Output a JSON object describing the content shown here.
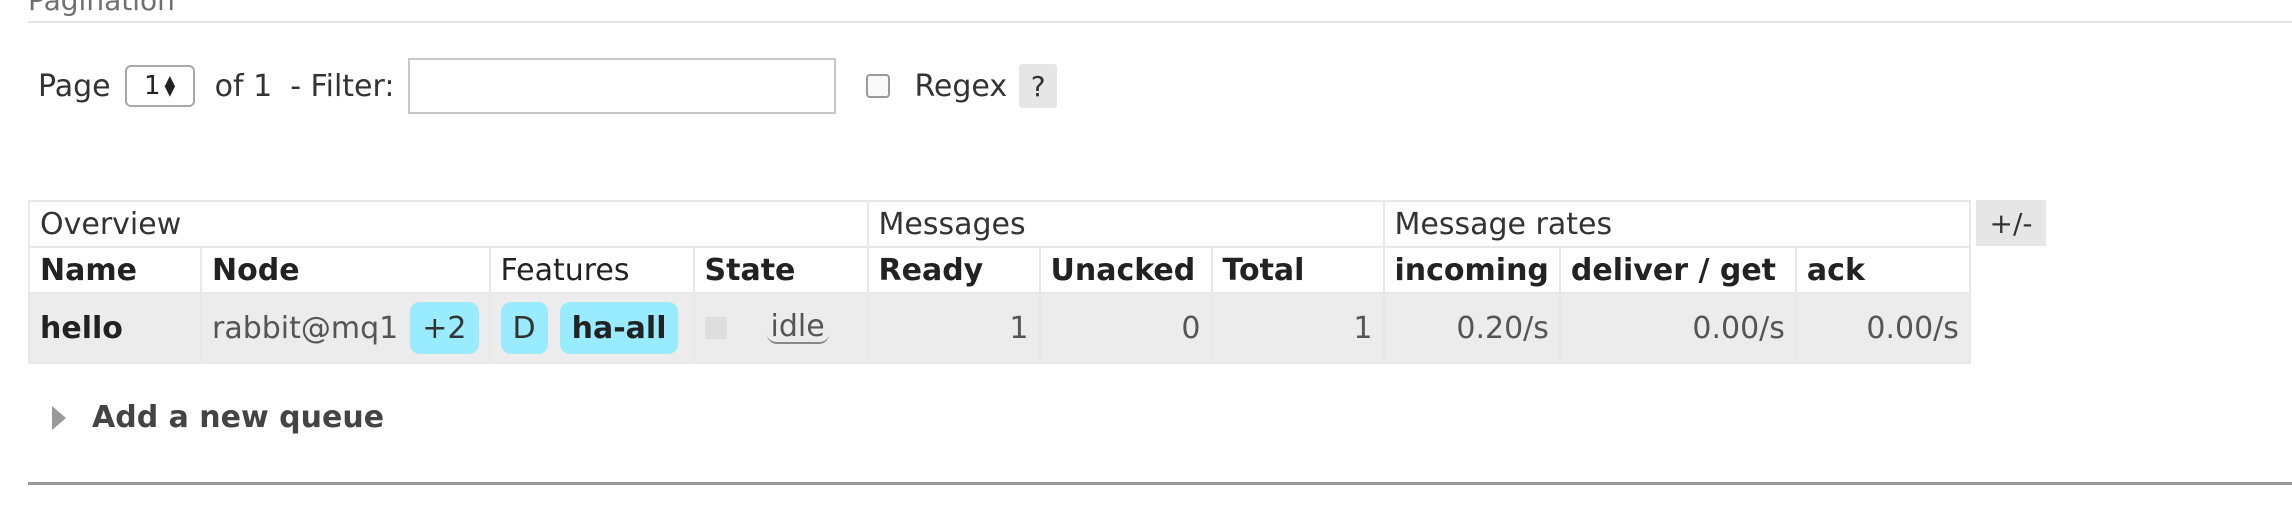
{
  "section": {
    "title": "Pagination"
  },
  "pagination": {
    "page_label": "Page",
    "page_value": "1",
    "of_label": "of 1",
    "filter_label": "- Filter:",
    "filter_value": "",
    "regex_checked": false,
    "regex_label": "Regex",
    "help_label": "?"
  },
  "table": {
    "groups": [
      "Overview",
      "Messages",
      "Message rates"
    ],
    "columns": [
      "Name",
      "Node",
      "Features",
      "State",
      "Ready",
      "Unacked",
      "Total",
      "incoming",
      "deliver / get",
      "ack"
    ],
    "rows": [
      {
        "name": "hello",
        "node": "rabbit@mq1",
        "node_extra": "+2",
        "feature_durable": "D",
        "feature_policy": "ha-all",
        "state": "idle",
        "ready": "1",
        "unacked": "0",
        "total": "1",
        "incoming": "0.20/s",
        "deliver_get": "0.00/s",
        "ack": "0.00/s"
      }
    ],
    "column_toggle_label": "+/-"
  },
  "add_queue": {
    "label": "Add a new queue"
  },
  "colors": {
    "badge_bg": "#99ebff",
    "row_bg": "#ececec"
  }
}
